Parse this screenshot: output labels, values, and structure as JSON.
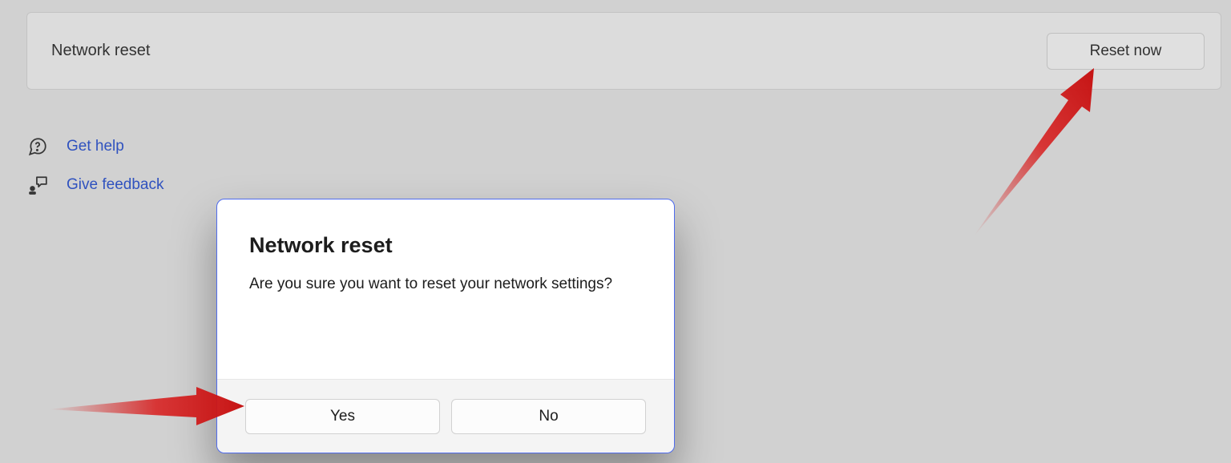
{
  "card": {
    "title": "Network reset",
    "button_label": "Reset now"
  },
  "links": {
    "get_help": "Get help",
    "give_feedback": "Give feedback"
  },
  "dialog": {
    "title": "Network reset",
    "message": "Are you sure you want to reset your network settings?",
    "yes_label": "Yes",
    "no_label": "No"
  },
  "annotations": {
    "arrow_color": "#d81a1a"
  }
}
